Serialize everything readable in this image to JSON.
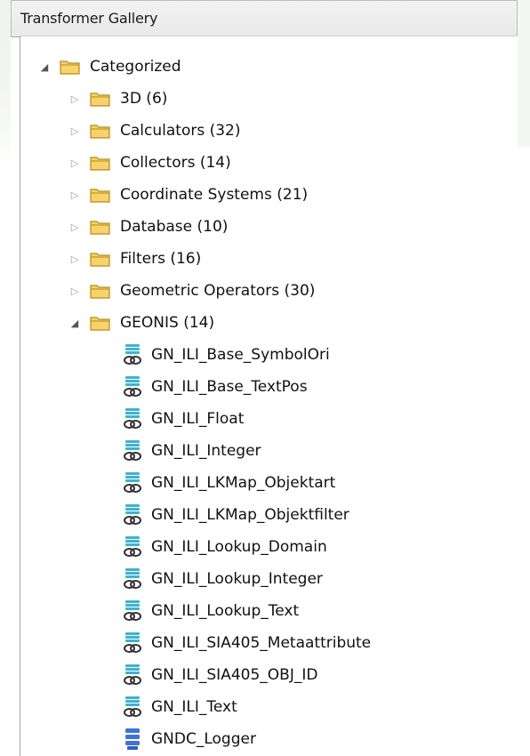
{
  "panel": {
    "title": "Transformer Gallery"
  },
  "tree": {
    "root": {
      "label": "Categorized",
      "expanded": true,
      "icon": "folder-icon"
    },
    "categories": [
      {
        "label": "3D (6)",
        "expanded": false
      },
      {
        "label": "Calculators (32)",
        "expanded": false
      },
      {
        "label": "Collectors (14)",
        "expanded": false
      },
      {
        "label": "Coordinate Systems (21)",
        "expanded": false
      },
      {
        "label": "Database (10)",
        "expanded": false
      },
      {
        "label": "Filters (16)",
        "expanded": false
      },
      {
        "label": "Geometric Operators (30)",
        "expanded": false
      },
      {
        "label": "GEONIS (14)",
        "expanded": true
      }
    ],
    "geonis_items": [
      {
        "label": "GN_ILI_Base_SymbolOri",
        "icon": "custom-transformer-icon"
      },
      {
        "label": "GN_ILI_Base_TextPos",
        "icon": "custom-transformer-icon"
      },
      {
        "label": "GN_ILI_Float",
        "icon": "custom-transformer-icon"
      },
      {
        "label": "GN_ILI_Integer",
        "icon": "custom-transformer-icon"
      },
      {
        "label": "GN_ILI_LKMap_Objektart",
        "icon": "custom-transformer-icon"
      },
      {
        "label": "GN_ILI_LKMap_Objektfilter",
        "icon": "custom-transformer-icon"
      },
      {
        "label": "GN_ILI_Lookup_Domain",
        "icon": "custom-transformer-icon"
      },
      {
        "label": "GN_ILI_Lookup_Integer",
        "icon": "custom-transformer-icon"
      },
      {
        "label": "GN_ILI_Lookup_Text",
        "icon": "custom-transformer-icon"
      },
      {
        "label": "GN_ILI_SIA405_Metaattribute",
        "icon": "custom-transformer-icon"
      },
      {
        "label": "GN_ILI_SIA405_OBJ_ID",
        "icon": "custom-transformer-icon"
      },
      {
        "label": "GN_ILI_Text",
        "icon": "custom-transformer-icon"
      },
      {
        "label": "GNDC_Logger",
        "icon": "transformer-icon"
      }
    ]
  },
  "colors": {
    "folder_fill": "#f7d36b",
    "folder_stroke": "#b98a18",
    "custom_icon_top": "#3bb4d0",
    "custom_icon_link": "#333333",
    "transformer_icon": "#3f73d8"
  }
}
